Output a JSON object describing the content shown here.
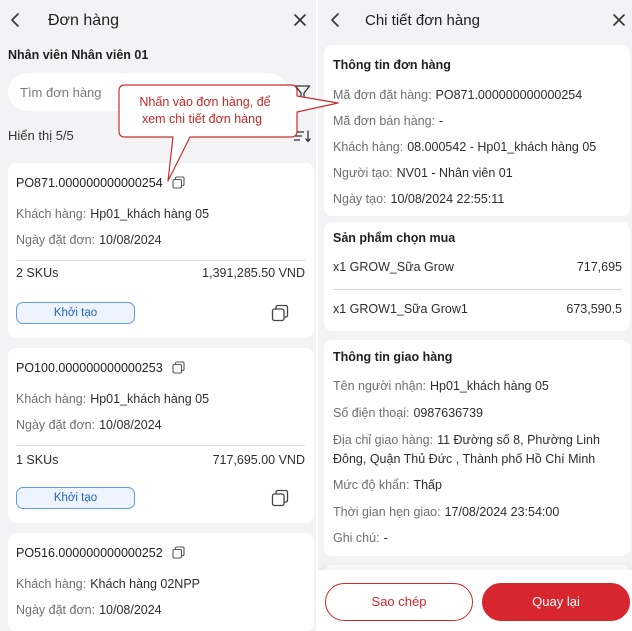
{
  "colors": {
    "accent_red": "#d7262e",
    "badge_blue": "#1f63c6",
    "badge_border": "#5e9be6",
    "panel_bg": "#f3f3f5",
    "annotation_red": "#c8302e"
  },
  "order_list": {
    "header": {
      "back_icon": "chevron-left-icon",
      "title": "Đơn hàng",
      "close_icon": "close-icon"
    },
    "employee": "Nhân viên Nhân viên 01",
    "search": {
      "placeholder": "Tìm đơn hàng",
      "value": "",
      "filter_icon": "filter-icon"
    },
    "count_text": "Hiển thị 5/5",
    "sort_icon": "sort-icon",
    "orders": [
      {
        "code": "PO871.000000000000254",
        "customer_label": "Khách hàng:",
        "customer": "Hp01_khách hàng 05",
        "date_label": "Ngày đặt đơn:",
        "date": "10/08/2024",
        "skus": "2 SKUs",
        "total": "1,391,285.50 VND",
        "status": "Khởi tạo"
      },
      {
        "code": "PO100.000000000000253",
        "customer_label": "Khách hàng:",
        "customer": "Hp01_khách hàng 05",
        "date_label": "Ngày đặt đơn:",
        "date": "10/08/2024",
        "skus": "1 SKUs",
        "total": "717,695.00 VND",
        "status": "Khởi tạo"
      },
      {
        "code": "PO516.000000000000252",
        "customer_label": "Khách hàng:",
        "customer": "Khách hàng 02NPP",
        "date_label": "Ngày đặt đơn:",
        "date": "10/08/2024"
      }
    ]
  },
  "order_detail": {
    "header": {
      "back_icon": "chevron-left-icon",
      "title": "Chi tiết đơn hàng",
      "close_icon": "close-icon"
    },
    "order_info": {
      "title": "Thông tin đơn hàng",
      "rows": [
        {
          "label": "Mã đơn đặt hàng:",
          "value": "PO871.000000000000254"
        },
        {
          "label": "Mã đơn bán hàng:",
          "value": "-"
        },
        {
          "label": "Khách hàng:",
          "value": "08.000542 - Hp01_khách hàng 05"
        },
        {
          "label": "Người tạo:",
          "value": "NV01 - Nhân viên 01"
        },
        {
          "label": "Ngày tạo:",
          "value": "10/08/2024 22:55:11"
        }
      ]
    },
    "products": {
      "title": "Sản phẩm chọn mua",
      "items": [
        {
          "name": "x1 GROW_Sữa Grow",
          "price": "717,695"
        },
        {
          "name": "x1 GROW1_Sữa Grow1",
          "price": "673,590.5"
        }
      ]
    },
    "delivery": {
      "title": "Thông tin giao hàng",
      "rows": [
        {
          "label": "Tên người nhận:",
          "value": "Hp01_khách hàng 05"
        },
        {
          "label": "Số điện thoại:",
          "value": "0987636739"
        },
        {
          "label": "Địa chỉ giao hàng:",
          "value": "11 Đường số 8, Phường Linh Đông, Quận Thủ Đức , Thành phố Hồ Chí Minh"
        },
        {
          "label": "Mức độ khẩn:",
          "value": "Thấp"
        },
        {
          "label": "Thời gian hẹn giao:",
          "value": "17/08/2024 23:54:00"
        },
        {
          "label": "Ghi chú:",
          "value": "-"
        }
      ]
    },
    "actions": {
      "copy_label": "Sao chép",
      "back_label": "Quay lại"
    }
  },
  "annotation": {
    "line1": "Nhấn vào đơn hàng, để",
    "line2": "xem chi tiết đơn hàng"
  }
}
